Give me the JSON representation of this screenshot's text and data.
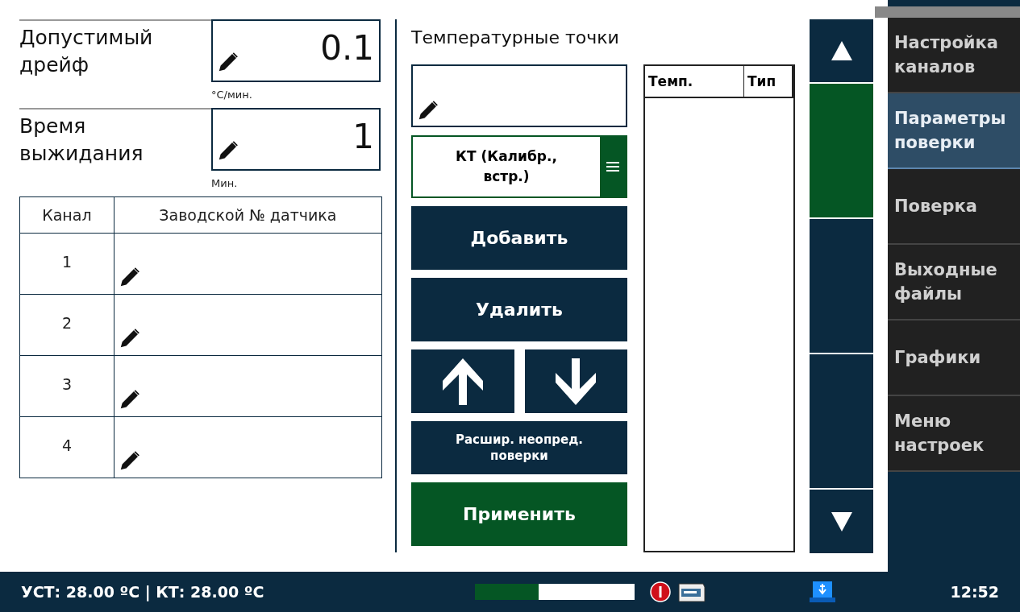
{
  "settings": [
    {
      "label": "Допустимый дрейф",
      "value": "0.1",
      "unit": "°C/мин."
    },
    {
      "label": "Время выжидания",
      "value": "1",
      "unit": "Мин."
    }
  ],
  "channels_table": {
    "columns": [
      "Канал",
      "Заводской № датчика"
    ],
    "rows": [
      {
        "channel": "1"
      },
      {
        "channel": "2"
      },
      {
        "channel": "3"
      },
      {
        "channel": "4"
      }
    ]
  },
  "points": {
    "title": "Температурные точки",
    "type_select": {
      "value": "КТ (Калибр., встр.)"
    },
    "buttons": [
      {
        "kind": "text",
        "label": "Добавить"
      },
      {
        "kind": "text",
        "label": "Удалить"
      }
    ],
    "move_buttons": [
      {
        "kind": "up"
      },
      {
        "kind": "down"
      }
    ],
    "extra_button": {
      "label": "Расшир. неопред. поверки"
    },
    "apply_button": {
      "label": "Применить"
    },
    "list": {
      "columns": [
        "Темп.",
        "Тип"
      ]
    }
  },
  "nav": [
    {
      "label": "Настройка каналов",
      "selected": false
    },
    {
      "label": "Параметры поверки",
      "selected": true
    },
    {
      "label": "Поверка",
      "selected": false
    },
    {
      "label": "Выходные файлы",
      "selected": false
    },
    {
      "label": "Графики",
      "selected": false
    },
    {
      "label": "Меню настроек",
      "selected": false
    }
  ],
  "status_bar": {
    "text": "УСТ: 28.00 ºC | КТ: 28.00 ºC",
    "progress": {
      "level": 0.4
    },
    "time": "12:52"
  }
}
